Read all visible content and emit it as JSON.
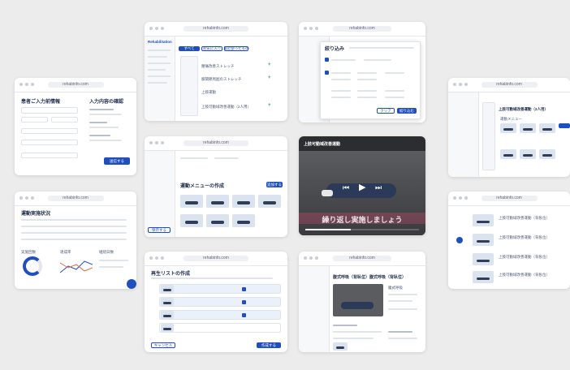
{
  "domain_url": "rehabinfo.com",
  "colors": {
    "accent": "#1f4fbf",
    "background": "#ececec",
    "dark_panel": "#2c2d30"
  },
  "screens": {
    "signup": {
      "title": "患者ご入力前情報",
      "right_title": "入力内容の確認",
      "submit": "送信する"
    },
    "menu_list": {
      "logo": "Rehabilitation",
      "tabs": [
        "すべて",
        "お気に入り",
        "最近使ったもの"
      ],
      "rows": [
        "腰痛改善ストレッチ",
        "膝関節周囲のストレッチ",
        "上肢運動",
        "上肢可動域改善運動（2人用）"
      ]
    },
    "filter_modal": {
      "title": "絞り込み",
      "apply": "絞り込む",
      "clear": "クリア"
    },
    "right_list": {
      "header": "上肢可動域改善運動（2人用）",
      "section": "運動メニュー"
    },
    "menu_create": {
      "title": "運動メニューの作成",
      "add": "追加する",
      "save": "保存する"
    },
    "video": {
      "title": "上肢可動域改善運動",
      "caption": "繰り返し実施しましょう"
    },
    "status": {
      "title": "運動実施状況",
      "items": [
        "実施回数",
        "達成率",
        "継続日数"
      ]
    },
    "exercise_list": {
      "rows": [
        "上肢可動域改善運動（背臥位）",
        "上肢可動域改善運動（背臥位）",
        "上肢可動域改善運動（背臥位）",
        "上肢可動域改善運動（背臥位）"
      ]
    },
    "playlist": {
      "title": "再生リストの作成",
      "create": "作成する",
      "cancel": "キャンセル"
    },
    "detail": {
      "title": "腹式呼吸（背臥位）腹式呼吸（背臥位）",
      "sub": "腹式呼吸"
    }
  }
}
